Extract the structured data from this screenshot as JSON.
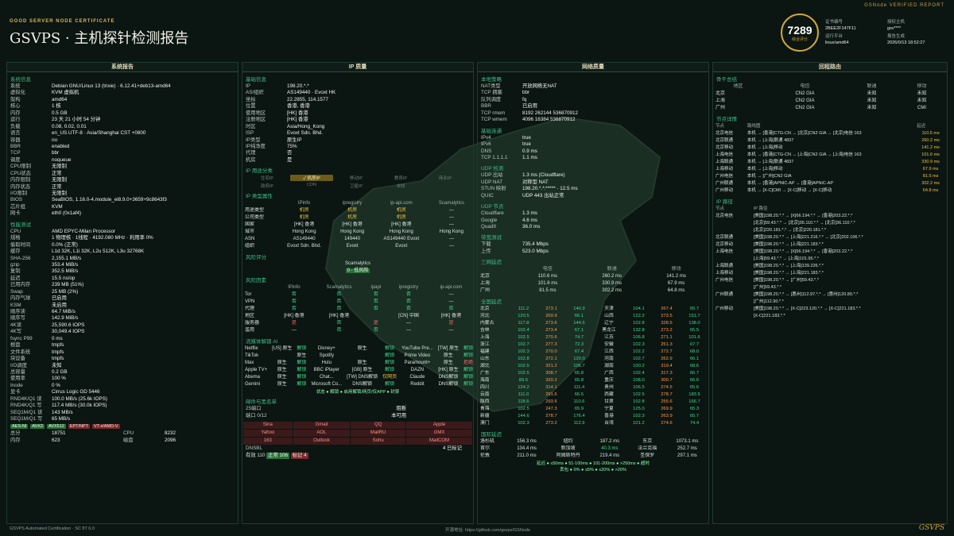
{
  "header": {
    "subtitle": "GOOD SERVER NODE CERTIFICATE",
    "title": "GSVPS · 主机探针检测报告",
    "verified": "GSNode VERIFIED REPORT",
    "score": "7289",
    "score_label": "综合评分",
    "cert": [
      [
        "证书编号",
        "2BEE2F147F11"
      ],
      [
        "运行平台",
        "linux/amd64"
      ],
      [
        "报告生成",
        "2026/0/13 18:52:27"
      ],
      [
        "授权主机",
        "gsv****"
      ]
    ]
  },
  "sysinfo": {
    "title": "系统报告",
    "s1": "系统信息",
    "rows": [
      [
        "系统",
        "Debian GNU/Linux 13 (trixie) · 6.12.41+deb13-amd64"
      ],
      [
        "虚拟化",
        "KVM 虚拟机"
      ],
      [
        "架构",
        "amd64"
      ],
      [
        "核心",
        "1 核"
      ],
      [
        "内存",
        "0.5 GB"
      ],
      [
        "运行",
        "23 天 21 小时 54 分钟"
      ],
      [
        "负载",
        "0.08, 0.02, 0.01"
      ],
      [
        "语言",
        "en_US.UTF-8 · Asia/Shanghai CST +0800"
      ],
      [
        "容器",
        "no"
      ],
      [
        "BBR",
        "enabled"
      ],
      [
        "TCP",
        "bbr"
      ],
      [
        "调度",
        "noqueue"
      ],
      [
        "CPU限制",
        "无限制"
      ],
      [
        "CPU状态",
        "正常"
      ],
      [
        "内存限制",
        "无限制"
      ],
      [
        "内存状态",
        "正常"
      ],
      [
        "I/O限制",
        "无限制"
      ],
      [
        "BIOS",
        "SeaBIOS, 1.16.0-4.module_el8.9.0+3659+9c8643f3"
      ],
      [
        "芯片组",
        "KVM"
      ],
      [
        "网卡",
        "eth0 (0x1af4)"
      ]
    ],
    "s2": "性能测试",
    "rows2": [
      [
        "CPU",
        "AMD EPYC-Milan Processor"
      ],
      [
        "规格",
        "1 物理核 · 1线程 · 4192.080 MHz · 利用率 0%"
      ],
      [
        "偷取时间",
        "0.0% (正常)"
      ],
      [
        "缓存",
        "L1d 32K, L1i 32K, L2u 512K, L3u 32768K"
      ],
      [
        "SHA-256",
        "2,155.1 MB/s"
      ],
      [
        "gzip",
        "353.4 MiB/s"
      ],
      [
        "复制",
        "352.5 MiB/s"
      ],
      [
        "延迟",
        "15.5 ns/op"
      ],
      [
        "已用内存",
        "239 MB (51%)"
      ],
      [
        "Swap",
        "25 MB (2%)"
      ],
      [
        "内存气球",
        "已启用"
      ],
      [
        "KSM",
        "未启用"
      ],
      [
        "顺序读",
        "64.7 MiB/s"
      ],
      [
        "顺序写",
        "142.9 MiB/s"
      ],
      [
        "4K读",
        "25,590.6 IOPS"
      ],
      [
        "4K写",
        "30,049.4 IOPS"
      ],
      [
        "fsync P99",
        "0 ms"
      ],
      [
        "根盘",
        "tmpfs"
      ],
      [
        "文件系统",
        "tmpfs"
      ],
      [
        "块设备",
        "tmpfs"
      ],
      [
        "I/O调度",
        "未知"
      ],
      [
        "总容量",
        "0.2 GB"
      ],
      [
        "使用率",
        "100 %"
      ],
      [
        "Inode",
        "0 %"
      ],
      [
        "显卡",
        "Cirrus Logic GD 5446"
      ],
      [
        "RND4K/Q1 读",
        "100.0 MB/s (25.6k IOPS)"
      ],
      [
        "RND4K/Q1 写",
        "117.4 MB/s (30.0k IOPS)"
      ],
      [
        "SEQ1M/Q1 读",
        "143 MB/s"
      ],
      [
        "SEQ1M/Q1 写",
        "65 MB/s"
      ]
    ],
    "flags": [
      "AES-NI",
      "AVX2",
      "AVX512",
      "EPT/NPT",
      "VT-x/AMD-V"
    ],
    "score_cpu": "CPU",
    "score_cpu_v": "8232",
    "score_tot": "总分",
    "score_tot_v": "18751",
    "mem": "内存",
    "mem_v": "2096",
    "disk": "磁盘",
    "disk_v": "623"
  },
  "ipq": {
    "title": "IP 质量",
    "s1": "基础信息",
    "rows": [
      [
        "IP",
        "198.20.*.*"
      ],
      [
        "AS/组织",
        "AS149440 · Evoxt HK"
      ],
      [
        "坐标",
        "22.2855, 114.1577"
      ],
      [
        "位置",
        "香港, 香港"
      ],
      [
        "使用地区",
        "[HK] 香港"
      ],
      [
        "注册地区",
        "[HK] 香港"
      ],
      [
        "时区",
        "Asia/Hong_Kong"
      ],
      [
        "ISP",
        "Evoxt Sdn. Bhd."
      ],
      [
        "IP类型",
        "原生IP"
      ],
      [
        "IP纯净度",
        "75%"
      ],
      [
        "代理",
        "否"
      ],
      [
        "机房",
        "是"
      ]
    ],
    "s2": "IP 用途分类",
    "usage": [
      "住宅IP",
      "✓ 机房IP",
      "移动IP",
      "教育IP",
      "商业IP",
      "政府IP",
      "CDN",
      "卫星IP",
      "未知"
    ],
    "s3": "IP 类型属性",
    "srcs": [
      "IPinfo",
      "ipregistry",
      "ip-api.com",
      "Scamalytics"
    ],
    "attr": [
      [
        "用途类型",
        "机房",
        "机房",
        "机房",
        "—"
      ],
      [
        "公司类型",
        "机房",
        "机房",
        "机房",
        "—"
      ],
      [
        "国家",
        "[HK] 香港",
        "[HK] 香港",
        "[HK] 香港",
        "—"
      ],
      [
        "城市",
        "Hong Kong",
        "Hong Kong",
        "Hong Kong",
        "Hong Kong"
      ],
      [
        "ASN",
        "AS149440",
        "149440",
        "AS149440 Evoxt",
        "—"
      ],
      [
        "组织",
        "Evoxt Sdn. Bhd.",
        "Evoxt",
        "Evoxt",
        "—"
      ]
    ],
    "s4": "风险评分",
    "risk_src": "Scamalytics",
    "risk_v": "0 · 低风险",
    "s5": "风险因素",
    "rsrc": [
      "IPinfo",
      "Scamalytics",
      "ipapi",
      "ipregistry",
      "ip-api.com"
    ],
    "rf": [
      [
        "Tor",
        "否",
        "否",
        "否",
        "否",
        "—"
      ],
      [
        "VPN",
        "否",
        "否",
        "否",
        "否",
        "—"
      ],
      [
        "代理",
        "否",
        "否",
        "否",
        "否",
        "否"
      ],
      [
        "地区",
        "[HK] 香港",
        "[HK] 香港",
        "",
        "[CN] 中国",
        "[HK] 香港"
      ],
      [
        "服务器",
        "是",
        "否",
        "是",
        "—",
        "是"
      ],
      [
        "滥用",
        "—",
        "否",
        "否",
        "—",
        "—"
      ]
    ],
    "s6": "流媒体解锁 AI",
    "stream": [
      [
        "Netflix",
        "[US] 原生",
        "解锁",
        "Disney+",
        "原生",
        "解锁",
        "YouTube Pre...",
        "[TW] 原生",
        "解锁"
      ],
      [
        "TikTok",
        "",
        "原生",
        "Spotify",
        "",
        "解锁",
        "Prime Video",
        "原生",
        "解锁"
      ],
      [
        "Max",
        "原生",
        "解锁",
        "Hulu",
        "原生",
        "解锁",
        "Paramount+",
        "原生",
        "拒绝"
      ],
      [
        "Apple TV+",
        "原生",
        "解锁",
        "BBC iPlayer",
        "[GB] 原生",
        "解锁",
        "DAZN",
        "[HK] 原生",
        "解锁"
      ],
      [
        "Abema",
        "原生",
        "解锁",
        "Chat...",
        "[TW] DNS解锁",
        "仅网页",
        "Claude",
        "DNS解锁",
        "解锁"
      ],
      [
        "Gemini",
        "原生",
        "解锁",
        "Microsoft Co...",
        "DNS解锁",
        "解锁",
        "Reddit",
        "DNS解锁",
        "解锁"
      ]
    ],
    "legend": "状态 ● 解锁 ● 启用解锁/网页/仅APP ● 封禁",
    "s7": "邮件与黑名单",
    "smtp": "25端口",
    "smtp_v": "阻断",
    "local": "端口 0/12",
    "local_v": "本可用",
    "mail": [
      [
        "Sina",
        "Gmail",
        "QQ",
        "Apple"
      ],
      [
        "Yahoo",
        "AOL",
        "MailRU",
        "GMX"
      ],
      [
        "163",
        "Outlook",
        "Sohu",
        "MailCOM"
      ]
    ],
    "dnsbl": "DNSBL",
    "dnsbl_v": "4 已标记",
    "bl_total": "有效 110",
    "bl_clean": "正常 106",
    "bl_mark": "标记 4"
  },
  "net": {
    "title": "网络质量",
    "s1": "本地策略",
    "rows": [
      [
        "NAT类型",
        "开放网络无NAT"
      ],
      [
        "TCP 拥塞",
        "bbr"
      ],
      [
        "队列调度",
        "fq"
      ],
      [
        "BBR",
        "已启用"
      ],
      [
        "TCP rmem",
        "8192 262144 536870912"
      ],
      [
        "TCP wmem",
        "4096 16384 536870912"
      ]
    ],
    "s2": "基础连通",
    "conn": [
      [
        "IPv4",
        "true"
      ],
      [
        "IPv6",
        "true"
      ],
      [
        "DNS",
        "0.9 ms"
      ],
      [
        "TCP 1.1.1.1",
        "1.1 ms"
      ]
    ],
    "s3": "UDP 检测",
    "udp": [
      [
        "UDP 出站",
        "1.3 ms (Cloudflare)"
      ],
      [
        "UDP NAT",
        "对称型 NAT"
      ],
      [
        "STUN 映射",
        "198.20.*.*:***** · 12.5 ms"
      ],
      [
        "QUIC",
        "UDP 443 出站正常"
      ]
    ],
    "s4": "UDP 节点",
    "udpn": [
      [
        "Cloudflare",
        "1.3 ms"
      ],
      [
        "Google",
        "4.6 ms"
      ],
      [
        "Quad9",
        "36.0 ms"
      ]
    ],
    "s5": "带宽测试",
    "bw": [
      [
        "下载",
        "735.4 Mbps"
      ],
      [
        "上传",
        "523.0 Mbps"
      ]
    ],
    "s6": "三网延迟",
    "ln_h": [
      "",
      "电信",
      "联通",
      "移动"
    ],
    "ln": [
      [
        "北京",
        "110.6 ms",
        "260.2 ms",
        "141.2 ms"
      ],
      [
        "上海",
        "101.6 ms",
        "330.9 ms",
        "67.9 ms"
      ],
      [
        "广州",
        "81.5 ms",
        "302.2 ms",
        "64.8 ms"
      ]
    ],
    "s7": "全国延迟",
    "pv_h": [
      "",
      "电信",
      "联通",
      "移动"
    ],
    "pv": [
      [
        "北京",
        "111.2",
        "273.1",
        "140.9",
        "天津",
        "104.1",
        "267.4",
        "65.7"
      ],
      [
        "河北",
        "120.5",
        "269.9",
        "66.1",
        "山西",
        "122.2",
        "273.5",
        "151.7"
      ],
      [
        "内蒙古",
        "117.8",
        "273.6",
        "144.6",
        "辽宁",
        "102.8",
        "328.5",
        "138.0"
      ],
      [
        "吉林",
        "102.4",
        "273.4",
        "67.1",
        "黑龙江",
        "132.8",
        "273.2",
        "65.5"
      ],
      [
        "上海",
        "102.5",
        "270.6",
        "74.7",
        "江苏",
        "106.8",
        "271.1",
        "101.6"
      ],
      [
        "浙江",
        "102.7",
        "277.3",
        "72.3",
        "安徽",
        "102.3",
        "251.3",
        "67.7"
      ],
      [
        "福建",
        "102.3",
        "270.0",
        "67.4",
        "江西",
        "102.2",
        "272.7",
        "68.0"
      ],
      [
        "山东",
        "102.8",
        "272.1",
        "120.0",
        "河南",
        "102.7",
        "262.9",
        "66.1"
      ],
      [
        "湖北",
        "102.5",
        "321.2",
        "106.7",
        "湖南",
        "100.2",
        "319.4",
        "68.6"
      ],
      [
        "广东",
        "102.5",
        "308.7",
        "65.8",
        "广西",
        "102.4",
        "317.3",
        "66.7"
      ],
      [
        "海南",
        "89.5",
        "320.2",
        "65.8",
        "重庆",
        "108.0",
        "300.7",
        "66.6"
      ],
      [
        "四川",
        "124.2",
        "314.1",
        "111.4",
        "贵州",
        "106.5",
        "274.5",
        "65.6"
      ],
      [
        "云南",
        "111.0",
        "291.6",
        "66.5",
        "西藏",
        "102.5",
        "278.7",
        "183.5"
      ],
      [
        "陕西",
        "118.6",
        "293.6",
        "110.6",
        "甘肃",
        "102.8",
        "255.6",
        "166.7"
      ],
      [
        "青海",
        "102.5",
        "247.3",
        "65.9",
        "宁夏",
        "125.0",
        "269.9",
        "65.3"
      ],
      [
        "新疆",
        "144.6",
        "278.7",
        "176.4",
        "香港",
        "102.3",
        "263.9",
        "65.7"
      ],
      [
        "澳门",
        "102.3",
        "273.2",
        "112.9",
        "台湾",
        "101.2",
        "274.6",
        "74.4"
      ]
    ],
    "s8": "国际延迟",
    "intl": [
      [
        "洛杉矶",
        "156.3 ms",
        "纽约",
        "187.2 ms",
        "东京",
        "1073.1 ms"
      ],
      [
        "首尔",
        "134.4 ms",
        "新加坡",
        "40.3 ms",
        "法兰克福",
        "252.7 ms"
      ],
      [
        "伦敦",
        "211.0 ms",
        "阿姆斯特丹",
        "219.4 ms",
        "圣保罗",
        "297.1 ms"
      ]
    ],
    "leg": "延迟 ● ≤50ms ● 51-100ms ● 101-200ms ● >250ms ● 超时",
    "leg2": "丢包 ● 0% ● ≤5% ● ≤20% ● >20%"
  },
  "route": {
    "title": "回程路由",
    "s1": "骨干总结",
    "rh": [
      "地区",
      "电信",
      "联通",
      "移动"
    ],
    "rs": [
      [
        "北京",
        "CN2 GIA",
        "未知",
        "未知"
      ],
      [
        "上海",
        "CN2 GIA",
        "未知",
        "未知"
      ],
      [
        "广州",
        "CN2 GIA",
        "未知",
        "CMI"
      ]
    ],
    "s2": "节点详情",
    "dh": [
      "节点",
      "路线图",
      "延迟"
    ],
    "det": [
      [
        "北京电信",
        "本机 → [香港]CTG-CN → [北京]CN2 GIA → [北京]电信 163",
        "110.6 ms"
      ],
      [
        "北京联通",
        "本机 → [上海]联通 4837",
        "260.2 ms"
      ],
      [
        "北京移动",
        "本机 → [上海]移动",
        "141.2 ms"
      ],
      [
        "上海电信",
        "本机 → [香港]CTG-CN → [上海]CN2 GIA → [上海]电信 163",
        "101.6 ms"
      ],
      [
        "上海联通",
        "本机 → [上海]联通 4837",
        "330.9 ms"
      ],
      [
        "上海移动",
        "本机 → [上海]移动",
        "67.9 ms"
      ],
      [
        "广州电信",
        "本机 → [广州]CN2 GIA",
        "81.5 ms"
      ],
      [
        "广州联通",
        "本机 → [香港]APNIC-AP → [香港]APNIC-AP",
        "302.2 ms"
      ],
      [
        "广州移动",
        "本机 → [X-C]CMI → [X-C]移动 → [X-C]移动",
        "64.8 ms"
      ]
    ],
    "s3": "IP 路径",
    "ph": [
      "节点",
      "IP 路径"
    ],
    "path": [
      [
        "北京电信",
        "[美国]198.20.*.* → [X]66.194.*.* → [香港]203.22.*.*"
      ],
      [
        "",
        "[北京]59.43.*.* → [北京]36.110.*.* → [北京]36.110.*.*"
      ],
      [
        "",
        "[北京]220.181.*.* → [北京]220.181.*.*"
      ],
      [
        "北京联通",
        "[美国]198.20.*.* → [上海]221.216.*.* → [北京]202.106.*.*"
      ],
      [
        "北京移动",
        "[美国]198.20.*.* → [上海]221.183.*.*"
      ],
      [
        "上海电信",
        "[美国]198.20.*.* → [X]66.194.*.* → [香港]203.22.*.*"
      ],
      [
        "",
        "[上海]59.43.*.* → [上海]101.95.*.*"
      ],
      [
        "上海联通",
        "[美国]198.20.*.* → [上海]139.226.*.*"
      ],
      [
        "上海移动",
        "[美国]198.20.*.* → [上海]221.183.*.*"
      ],
      [
        "广州电信",
        "[美国]198.20.*.* → [广州]59.43.*.*"
      ],
      [
        "",
        "[广州]59.43.*.*"
      ],
      [
        "广州联通",
        "[美国]198.20.*.* → [惠州]112.97.*.* → [惠州]120.80.*.*"
      ],
      [
        "",
        "[广州]112.90.*.*"
      ],
      [
        "广州移动",
        "[美国]198.20.*.* → [X-C]223.120.*.* → [X-C]221.183.*.*"
      ],
      [
        "",
        "[X-C]221.183.*.*"
      ]
    ]
  },
  "footer": {
    "left": "GSVPS Automated Certification · SC 8T 6.0",
    "mid": "开源地址: https://github.com/gsvps/GSNode",
    "brand": "GSVPS"
  }
}
